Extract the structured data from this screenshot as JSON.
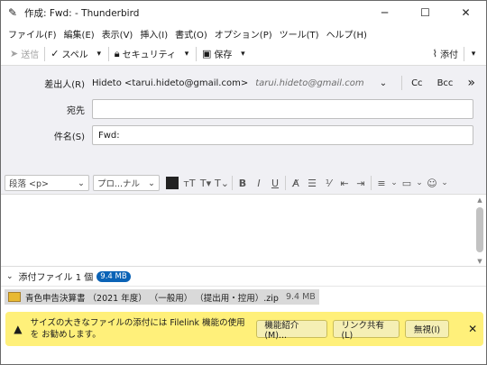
{
  "titlebar": {
    "icon": "pencil-icon",
    "title": "作成: Fwd: - Thunderbird",
    "minimize": "─",
    "maximize": "☐",
    "close": "✕"
  },
  "menu": [
    "ファイル(F)",
    "編集(E)",
    "表示(V)",
    "挿入(I)",
    "書式(O)",
    "オプション(P)",
    "ツール(T)",
    "ヘルプ(H)"
  ],
  "toolbar": {
    "send": "送信",
    "spell": "スペル",
    "security": "セキュリティ",
    "save": "保存",
    "attach": "添付"
  },
  "header": {
    "from_label": "差出人(R)",
    "from_value": "Hideto <tarui.hideto@gmail.com>",
    "from_email": "tarui.hideto@gmail.com",
    "cc": "Cc",
    "bcc": "Bcc",
    "more": "»",
    "to_label": "宛先",
    "to_value": "",
    "subject_label": "件名(S)",
    "subject_value": "Fwd:"
  },
  "format": {
    "paragraph": "段落 <p>",
    "font": "プロ...ナル"
  },
  "attachments": {
    "header": "添付ファイル 1 個",
    "total_size": "9.4 MB",
    "file_name": "青色申告決算書 （2021 年度） （一般用） （提出用・控用）.zip",
    "file_size": "9.4 MB"
  },
  "notification": {
    "message": "サイズの大きなファイルの添付には Filelink 機能の使用を お勧めします。",
    "btn_learn": "機能紹介(M)...",
    "btn_link": "リンク共有(L)",
    "btn_ignore": "無視(I)",
    "colors": {
      "background": "#fff07a"
    }
  }
}
